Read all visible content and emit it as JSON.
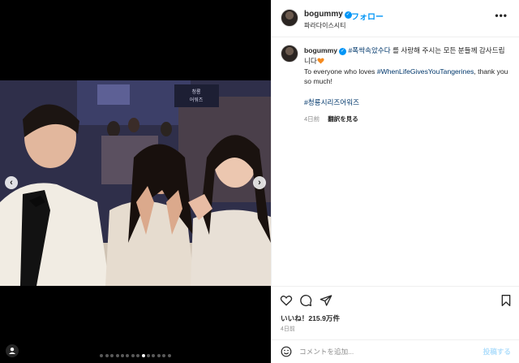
{
  "post": {
    "username": "bogummy",
    "follow_label": "フォロー",
    "location": "파라다이스시티",
    "more_label": "•••"
  },
  "caption": {
    "username": "bogummy",
    "tag1": "#폭싹속았수다",
    "text1": "를 사랑해 주시는 모든 분들께 감사드립니다",
    "text2": "To everyone who loves",
    "tag2": "#WhenLifeGivesYouTangerines",
    "text3": ", thank you so much!",
    "tag3": "#청룡시리즈어워즈",
    "time": "4日前",
    "see_translation": "翻訳を見る"
  },
  "photo": {
    "banner_text_1": "청룡",
    "banner_text_2": "어워즈"
  },
  "carousel": {
    "count": 14,
    "active_index": 8
  },
  "engagement": {
    "likes": "いいね！215.9万件",
    "time": "4日前"
  },
  "comment": {
    "placeholder": "コメントを追加...",
    "post_label": "投稿する"
  },
  "colors": {
    "accent": "#0095f6",
    "hashtag": "#00376b",
    "muted": "#8e8e8e",
    "post_disabled": "#b2dffc"
  },
  "icons": {
    "heart": "heart-icon",
    "comment": "comment-icon",
    "share": "share-icon",
    "save": "bookmark-icon",
    "emoji": "emoji-icon",
    "tagged": "user-tag-icon"
  }
}
